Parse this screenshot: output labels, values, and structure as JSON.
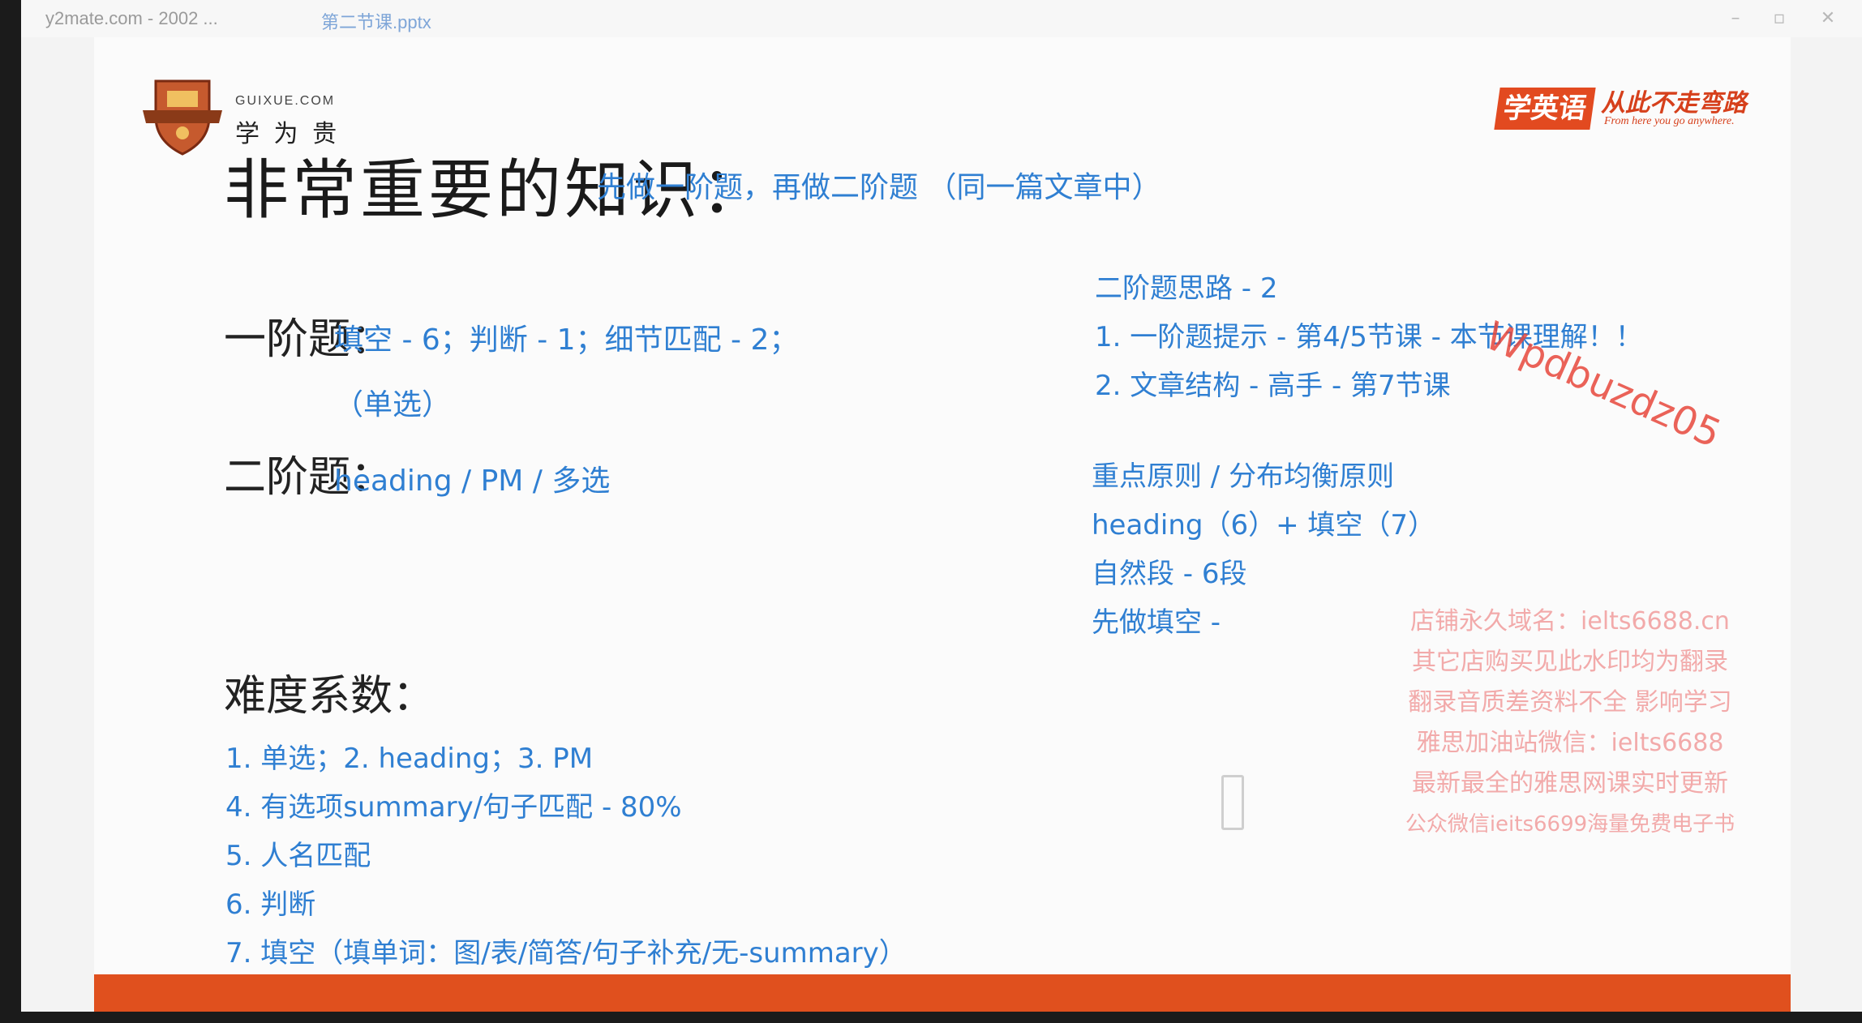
{
  "titlebar": {
    "source_text": "y2mate.com - 2002 ...",
    "file_tab": "第二节课.pptx"
  },
  "logo_left": {
    "domain": "GUIXUE.COM",
    "name": "学 为 贵"
  },
  "logo_right": {
    "badge": "学英语",
    "slogan": "从此不走弯路",
    "tagline": "From here you go anywhere."
  },
  "slide": {
    "title": "非常重要的知识：",
    "title_note": "先做一阶题，再做二阶题 （同一篇文章中）",
    "first_order": {
      "label": "一阶题：",
      "items": "填空 - 6；判断 - 1；细节匹配 - 2；",
      "items_cont": "（单选）"
    },
    "second_order": {
      "label": "二阶题：",
      "items": "heading / PM / 多选"
    },
    "difficulty": {
      "label": "难度系数：",
      "lines": [
        "1. 单选；2. heading；3. PM",
        "4. 有选项summary/句子匹配 - 80%",
        "5. 人名匹配",
        "6. 判断",
        "7. 填空（填单词：图/表/简答/句子补充/无-summary）"
      ]
    },
    "approach": {
      "heading": "二阶题思路 - 2",
      "lines": [
        "1. 一阶题提示 - 第4/5节课 - 本节课理解！！",
        "2. 文章结构 - 高手 - 第7节课"
      ]
    },
    "principles": {
      "lines": [
        "重点原则 / 分布均衡原则",
        "heading（6）+ 填空（7）",
        "自然段 - 6段",
        "先做填空 -"
      ]
    }
  },
  "watermarks": {
    "id": "Wpdbuzdz05",
    "shop_lines": [
      "店铺永久域名：ielts6688.cn",
      "其它店购买见此水印均为翻录",
      "翻录音质差资料不全 影响学习",
      "雅思加油站微信：ielts6688",
      "最新最全的雅思网课实时更新",
      "公众微信ieits6699海量免费电子书"
    ]
  }
}
